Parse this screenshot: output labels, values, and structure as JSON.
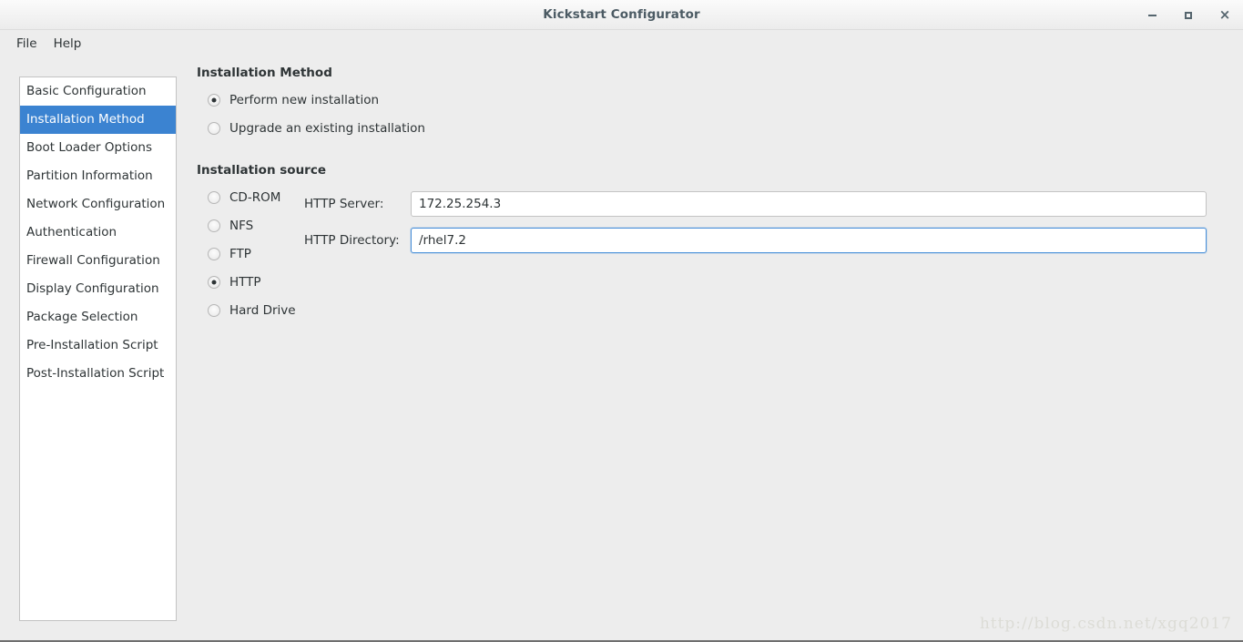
{
  "window": {
    "title": "Kickstart Configurator",
    "controls": {
      "minimize": "–",
      "maximize": "□",
      "close": "×"
    }
  },
  "menubar": {
    "items": [
      {
        "label": "File"
      },
      {
        "label": "Help"
      }
    ]
  },
  "sidebar": {
    "items": [
      {
        "label": "Basic Configuration",
        "selected": false
      },
      {
        "label": "Installation Method",
        "selected": true
      },
      {
        "label": "Boot Loader Options",
        "selected": false
      },
      {
        "label": "Partition Information",
        "selected": false
      },
      {
        "label": "Network Configuration",
        "selected": false
      },
      {
        "label": "Authentication",
        "selected": false
      },
      {
        "label": "Firewall Configuration",
        "selected": false
      },
      {
        "label": "Display Configuration",
        "selected": false
      },
      {
        "label": "Package Selection",
        "selected": false
      },
      {
        "label": "Pre-Installation Script",
        "selected": false
      },
      {
        "label": "Post-Installation Script",
        "selected": false
      }
    ]
  },
  "content": {
    "install_method": {
      "heading": "Installation Method",
      "options": [
        {
          "label": "Perform new installation",
          "selected": true
        },
        {
          "label": "Upgrade an existing installation",
          "selected": false
        }
      ]
    },
    "install_source": {
      "heading": "Installation source",
      "options": [
        {
          "label": "CD-ROM",
          "selected": false
        },
        {
          "label": "NFS",
          "selected": false
        },
        {
          "label": "FTP",
          "selected": false
        },
        {
          "label": "HTTP",
          "selected": true
        },
        {
          "label": "Hard Drive",
          "selected": false
        }
      ],
      "fields": [
        {
          "label": "HTTP Server:",
          "value": "172.25.254.3",
          "placeholder": "",
          "focused": false
        },
        {
          "label": "HTTP Directory:",
          "value": "/rhel7.2",
          "placeholder": "",
          "focused": true
        }
      ]
    }
  },
  "watermark": {
    "text": "http://blog.csdn.net/xgq2017"
  },
  "colors": {
    "accent": "#3b83d1",
    "focus_border": "#4a90d9",
    "background": "#ededed",
    "panel": "#ffffff",
    "text": "#2e3436",
    "title_text": "#4b5a63"
  }
}
